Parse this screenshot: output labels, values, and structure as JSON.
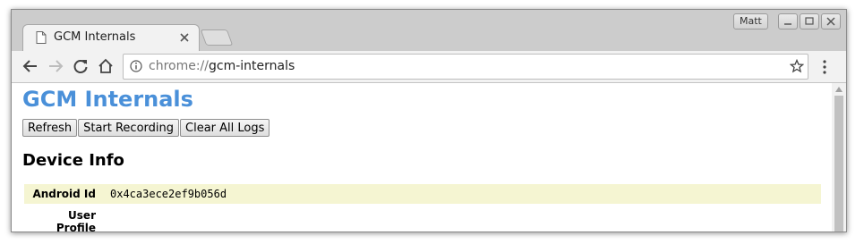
{
  "window": {
    "profile_name": "Matt",
    "controls": [
      "minimize",
      "maximize",
      "close"
    ]
  },
  "tabs": [
    {
      "title": "GCM Internals",
      "icon": "page-icon",
      "active": true
    }
  ],
  "toolbar": {
    "url_scheme": "chrome://",
    "url_path": "gcm-internals",
    "icons": [
      "back-icon",
      "forward-icon",
      "reload-icon",
      "home-icon",
      "info-icon",
      "star-icon",
      "menu-icon"
    ]
  },
  "page": {
    "title": "GCM Internals",
    "buttons": {
      "refresh": "Refresh",
      "start_recording": "Start Recording",
      "clear_all_logs": "Clear All Logs"
    },
    "section_title": "Device Info",
    "device_info": {
      "android_id_label": "Android Id",
      "android_id_value": "0x4ca3ece2ef9b056d",
      "user_profile_label_line1": "User",
      "user_profile_label_line2": "Profile"
    }
  },
  "colors": {
    "title_blue": "#4a90d9",
    "highlight_row": "#f5f5d2"
  }
}
